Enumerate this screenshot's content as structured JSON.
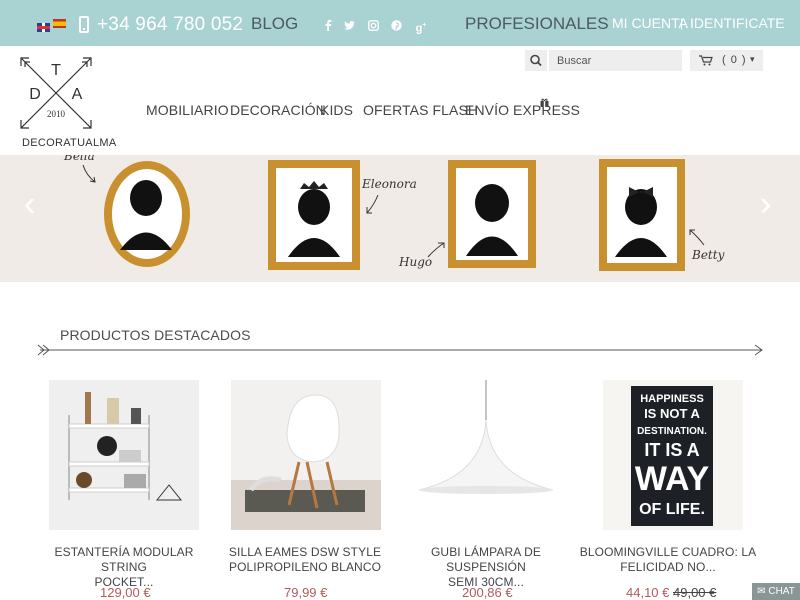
{
  "topbar": {
    "phone": "+34 964 780 052",
    "blog": "BLOG",
    "professionals": "PROFESIONALES",
    "my_account": "MI CUENTA",
    "separator": "|",
    "login": "IDENTIFICATE",
    "social_icons": [
      "facebook-icon",
      "twitter-icon",
      "instagram-icon",
      "pinterest-icon",
      "google-plus-icon"
    ],
    "languages": [
      "english-flag-icon",
      "spanish-flag-icon"
    ]
  },
  "logo": {
    "letters": [
      "T",
      "D",
      "A"
    ],
    "year": "2010",
    "name": "DECORATUALMA"
  },
  "search": {
    "placeholder": "Buscar"
  },
  "cart": {
    "count": "( 0 )",
    "caret": "▾"
  },
  "nav": [
    "MOBILIARIO",
    "DECORACIÓN",
    "KIDS",
    "OFERTAS FLASH",
    "ENVÍO EXPRESS"
  ],
  "banner": {
    "names": [
      "Bella",
      "Eleonora",
      "Hugo",
      "Betty"
    ],
    "prev": "‹",
    "next": "›"
  },
  "section": {
    "title": "PRODUCTOS DESTACADOS"
  },
  "products": [
    {
      "title_line1": "ESTANTERÍA MODULAR STRING",
      "title_line2": "POCKET...",
      "price": "129,00 €",
      "old_price": ""
    },
    {
      "title_line1": "SILLA EAMES DSW STYLE",
      "title_line2": "POLIPROPILENO BLANCO",
      "price": "79,99 €",
      "old_price": ""
    },
    {
      "title_line1": "GUBI LÁMPARA DE SUSPENSIÓN",
      "title_line2": "SEMI 30CM...",
      "price": "200,86 €",
      "old_price": ""
    },
    {
      "title_line1": "BLOOMINGVILLE CUADRO: LA",
      "title_line2": "FELICIDAD NO...",
      "price": "44,10 €",
      "old_price": "49,00 €"
    }
  ],
  "poster": [
    "HAPPINESS",
    "IS NOT A",
    "DESTINATION.",
    "IT IS A",
    "WAY",
    "OF LIFE."
  ],
  "chat": {
    "label": "CHAT"
  },
  "colors": {
    "topbar": "#a9d2d3",
    "price": "#b05a5a",
    "banner_bg": "#f1ebe8",
    "frame_gold": "#c8902e"
  }
}
